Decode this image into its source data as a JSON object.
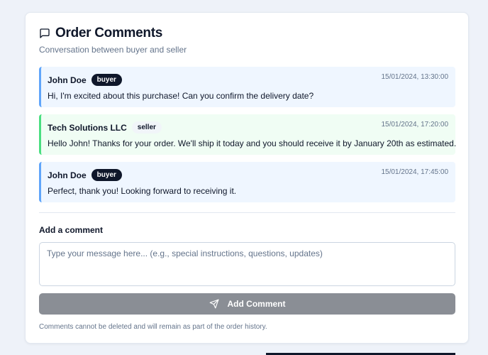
{
  "header": {
    "title": "Order Comments",
    "subtitle": "Conversation between buyer and seller",
    "icon": "message-square-icon"
  },
  "comments": [
    {
      "author": "John Doe",
      "role": "buyer",
      "timestamp": "15/01/2024, 13:30:00",
      "text": "Hi, I'm excited about this purchase! Can you confirm the delivery date?"
    },
    {
      "author": "Tech Solutions LLC",
      "role": "seller",
      "timestamp": "15/01/2024, 17:20:00",
      "text": "Hello John! Thanks for your order. We'll ship it today and you should receive it by January 20th as estimated."
    },
    {
      "author": "John Doe",
      "role": "buyer",
      "timestamp": "15/01/2024, 17:45:00",
      "text": "Perfect, thank you! Looking forward to receiving it."
    }
  ],
  "form": {
    "label": "Add a comment",
    "value": "",
    "placeholder": "Type your message here... (e.g., special instructions, questions, updates)",
    "submit_label": "Add Comment",
    "submit_icon": "send-icon",
    "note": "Comments cannot be deleted and will remain as part of the order history."
  },
  "colors": {
    "buyer_bg": "#eff6ff",
    "buyer_border": "#60a5fa",
    "seller_bg": "#f0fdf4",
    "seller_border": "#4ade80",
    "button_disabled": "#8a8e95"
  }
}
